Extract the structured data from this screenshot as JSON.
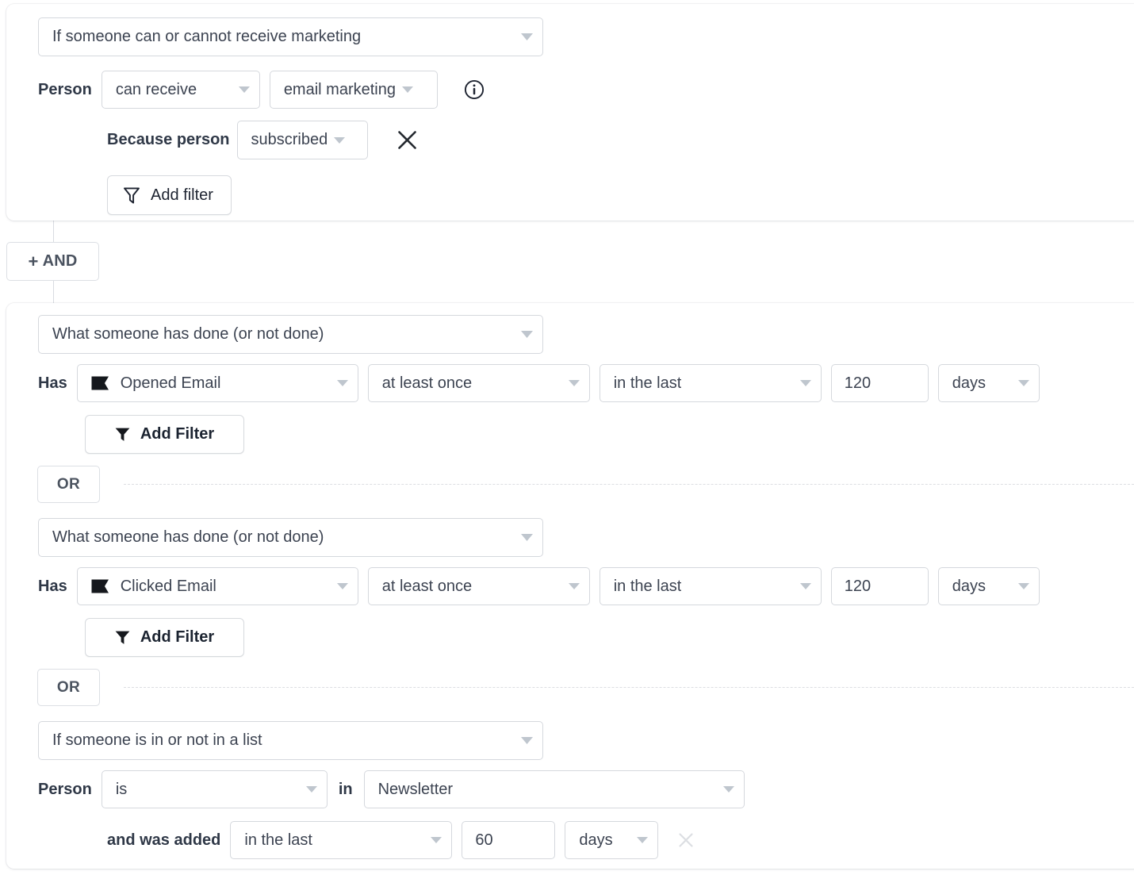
{
  "groups": [
    {
      "type_select": {
        "value": "If someone can or cannot receive marketing",
        "icon": "chevron-down-icon"
      },
      "rows": [
        {
          "label": "Person",
          "fields": [
            {
              "value": "can receive"
            },
            {
              "value": "email marketing"
            }
          ],
          "info_icon": "info-icon"
        },
        {
          "label": "Because person",
          "fields": [
            {
              "value": "subscribed"
            }
          ],
          "remove_icon": "close-icon"
        }
      ],
      "add_filter": {
        "label": "Add filter",
        "icon": "filter-outline-icon"
      }
    }
  ],
  "and_button": {
    "label": "AND",
    "plus": "+",
    "icon": "plus-icon"
  },
  "group2": {
    "blocks": [
      {
        "type_select": {
          "value": "What someone has done (or not done)"
        },
        "label": "Has",
        "metric": {
          "value": "Opened Email",
          "icon": "flag-icon"
        },
        "frequency": {
          "value": "at least once"
        },
        "timeframe": {
          "value": "in the last"
        },
        "amount": {
          "value": "120"
        },
        "unit": {
          "value": "days"
        },
        "add_filter": {
          "label": "Add Filter",
          "icon": "filter-solid-icon"
        }
      },
      {
        "type_select": {
          "value": "What someone has done (or not done)"
        },
        "label": "Has",
        "metric": {
          "value": "Clicked Email",
          "icon": "flag-icon"
        },
        "frequency": {
          "value": "at least once"
        },
        "timeframe": {
          "value": "in the last"
        },
        "amount": {
          "value": "120"
        },
        "unit": {
          "value": "days"
        },
        "add_filter": {
          "label": "Add Filter",
          "icon": "filter-solid-icon"
        }
      },
      {
        "type_select": {
          "value": "If someone is in or not in a list"
        },
        "label": "Person",
        "operator": {
          "value": "is"
        },
        "preposition": "in",
        "list": {
          "value": "Newsletter"
        },
        "sub_label": "and was added",
        "timeframe": {
          "value": "in the last"
        },
        "amount": {
          "value": "60"
        },
        "unit": {
          "value": "days"
        },
        "remove_icon": "close-icon-disabled"
      }
    ],
    "or_separators": [
      {
        "label": "OR"
      },
      {
        "label": "OR"
      }
    ]
  },
  "colors": {
    "card_border": "#e6e8ec",
    "field_border": "#d5d8dd",
    "text": "#3c4351",
    "label": "#2f3847",
    "caret": "#b5bcc6",
    "dashed": "#dcdee2",
    "icon_dark": "#1d2330"
  }
}
